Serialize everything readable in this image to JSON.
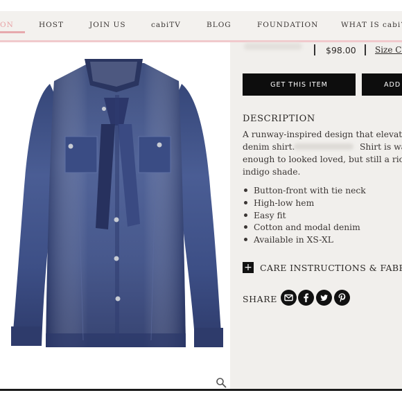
{
  "nav": {
    "items": [
      {
        "label": "ON",
        "active": true
      },
      {
        "label": "HOST"
      },
      {
        "label": "JOIN US"
      },
      {
        "label": "cabiTV"
      },
      {
        "label": "BLOG"
      },
      {
        "label": "FOUNDATION"
      },
      {
        "label": "WHAT IS cabi?"
      }
    ]
  },
  "product": {
    "price": "$98.00",
    "size_chart": "Size Ch",
    "primary_button": "GET THIS ITEM",
    "secondary_button": "ADD"
  },
  "description": {
    "title": "DESCRIPTION",
    "lines": [
      "A runway-inspired design that elevates",
      "denim shirt.",
      "Shirt is wa",
      "enough to looked loved, but still a rich",
      "indigo shade."
    ],
    "bullets": [
      "Button-front with tie neck",
      "High-low hem",
      "Easy fit",
      "Cotton and modal denim",
      "Available in XS-XL"
    ]
  },
  "care": {
    "label": "CARE INSTRUCTIONS & FABRIC",
    "icon": "plus-icon"
  },
  "share": {
    "label": "SHARE",
    "icons": [
      "email-icon",
      "facebook-icon",
      "twitter-icon",
      "pinterest-icon"
    ]
  },
  "colors": {
    "accent_pink": "#e8a3a6",
    "denim": "#3d4d80",
    "button_black": "#0d0d0d",
    "info_bg": "#f1efec"
  }
}
